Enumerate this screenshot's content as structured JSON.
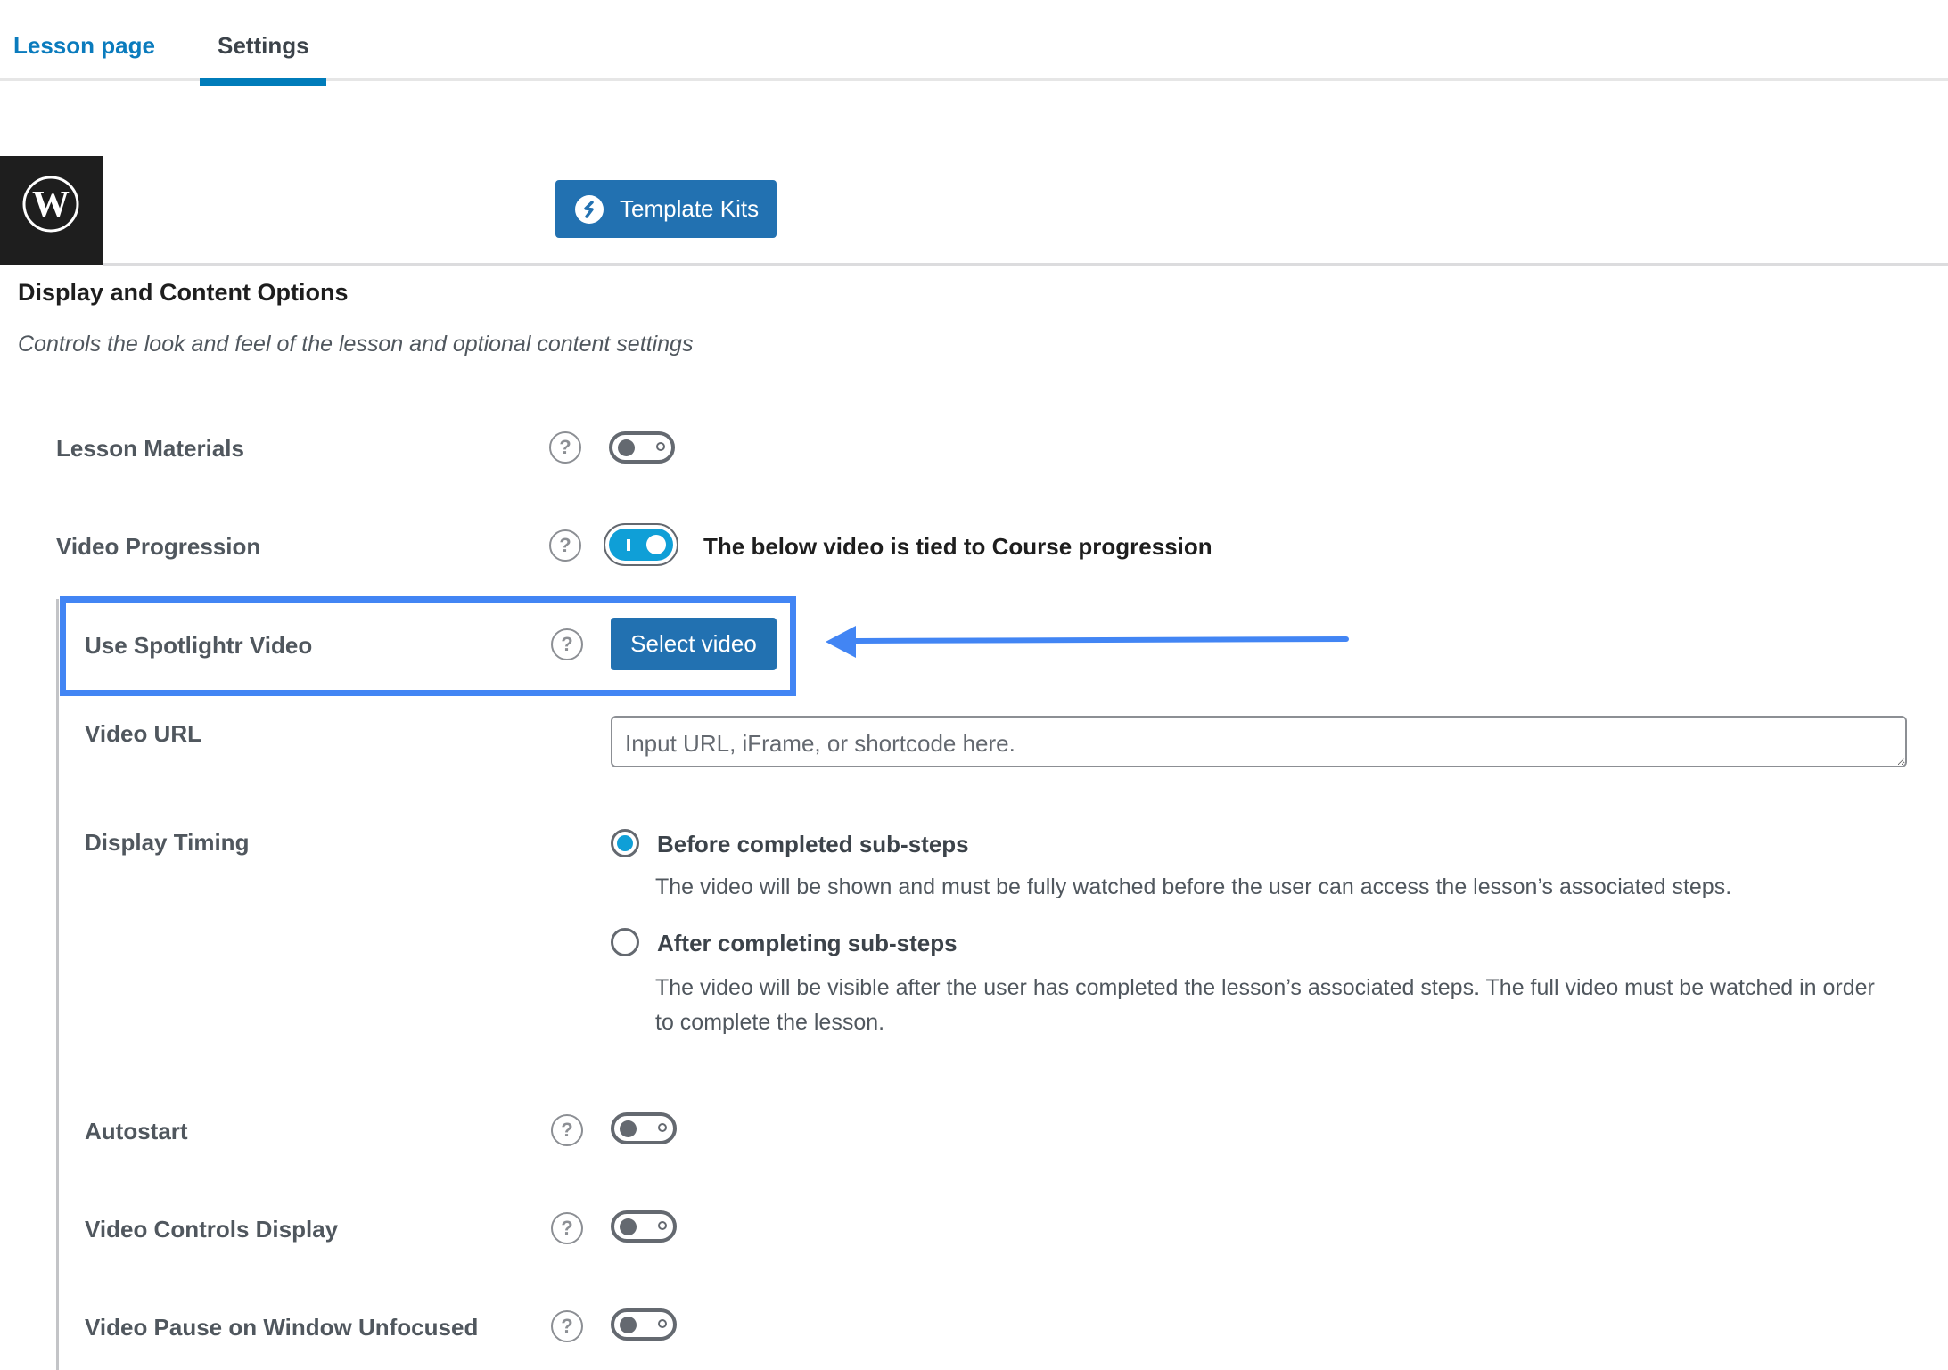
{
  "tabs": [
    {
      "label": "Lesson page",
      "active": false
    },
    {
      "label": "Settings",
      "active": true
    }
  ],
  "toolbar": {
    "template_kits_label": "Template Kits"
  },
  "section": {
    "title": "Display and Content Options",
    "description": "Controls the look and feel of the lesson and optional content settings"
  },
  "settings": {
    "lesson_materials": {
      "label": "Lesson Materials",
      "enabled": false
    },
    "video_progression": {
      "label": "Video Progression",
      "enabled": true,
      "caption": "The below video is tied to Course progression"
    },
    "spotlightr": {
      "label": "Use Spotlightr Video",
      "button_label": "Select video"
    },
    "video_url": {
      "label": "Video URL",
      "value": "",
      "placeholder": "Input URL, iFrame, or shortcode here."
    },
    "display_timing": {
      "label": "Display Timing",
      "selected": "before",
      "options": [
        {
          "id": "before",
          "label": "Before completed sub-steps",
          "description": "The video will be shown and must be fully watched before the user can access the lesson’s associated steps."
        },
        {
          "id": "after",
          "label": "After completing sub-steps",
          "description": "The video will be visible after the user has completed the lesson’s associated steps. The full video must be watched in order to complete the lesson."
        }
      ]
    },
    "autostart": {
      "label": "Autostart",
      "enabled": false
    },
    "video_controls_display": {
      "label": "Video Controls Display",
      "enabled": false
    },
    "video_pause_unfocused": {
      "label": "Video Pause on Window Unfocused",
      "enabled": false
    }
  },
  "help_icon_glyph": "?",
  "colors": {
    "accent": "#007cba",
    "button": "#2271b1",
    "toggle_on": "#0f9fd7",
    "annotation": "#4285f4"
  }
}
